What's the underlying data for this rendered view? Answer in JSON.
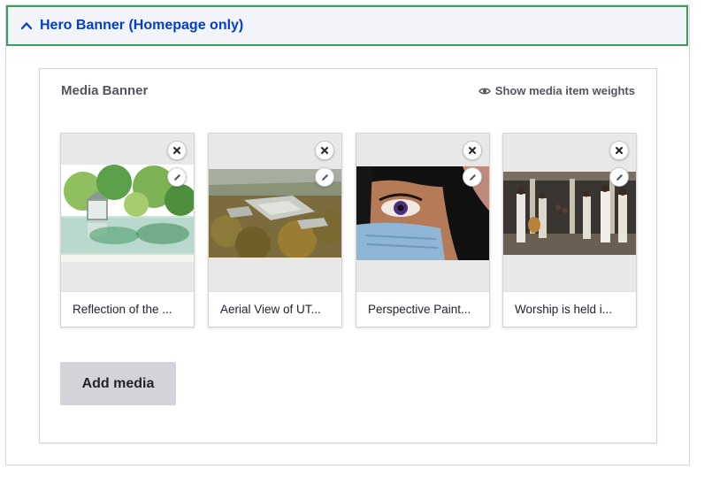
{
  "section": {
    "title": "Hero Banner (Homepage only)",
    "expanded": true
  },
  "field": {
    "label": "Media Banner",
    "weights_toggle": "Show media item weights",
    "add_button": "Add media"
  },
  "media_items": [
    {
      "caption": "Reflection of the ...",
      "icon": "watercolor-landscape"
    },
    {
      "caption": "Aerial View of UT...",
      "icon": "aerial-photo"
    },
    {
      "caption": "Perspective Paint...",
      "icon": "masked-eye-painting"
    },
    {
      "caption": "Worship is held i...",
      "icon": "worship-photo"
    }
  ],
  "colors": {
    "accent": "#003ecc",
    "focus_border": "#3a9e62",
    "header_bg": "#f3f4f9"
  }
}
